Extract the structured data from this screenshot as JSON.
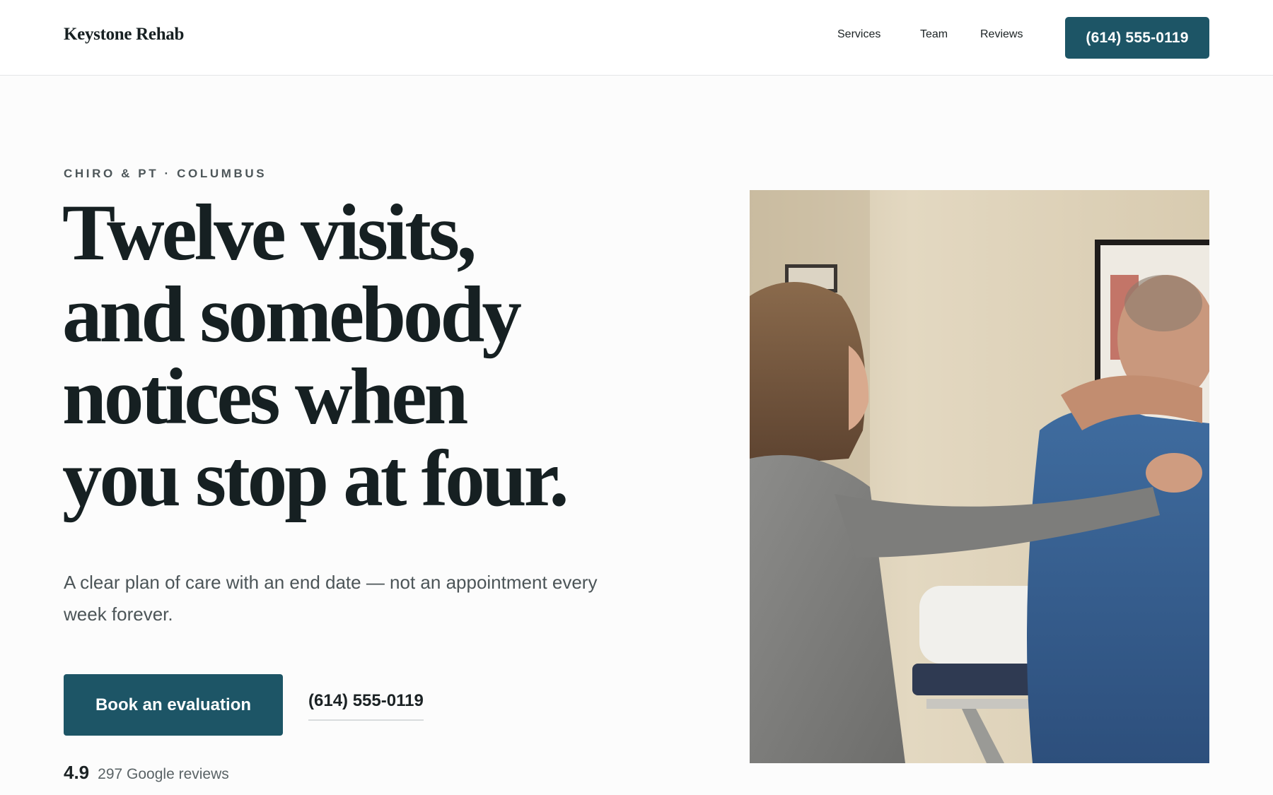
{
  "header": {
    "logo": "Keystone Rehab",
    "nav": [
      {
        "label": "Services"
      },
      {
        "label": "Team"
      },
      {
        "label": "Reviews"
      }
    ],
    "phone_button": "(614) 555-0119"
  },
  "hero": {
    "eyebrow": "CHIRO & PT · COLUMBUS",
    "headline_lines": [
      "Twelve visits,",
      "and somebody",
      "notices when",
      "you stop at four."
    ],
    "lede": "A clear plan of care with an end date — not an appointment every week forever.",
    "primary_cta": "Book an evaluation",
    "phone_link": "(614) 555-0119",
    "rating": {
      "score": "4.9",
      "text": "297 Google reviews"
    }
  },
  "photo": {
    "description_icon": "clinic-photo",
    "accent_color": "#1d5566"
  }
}
